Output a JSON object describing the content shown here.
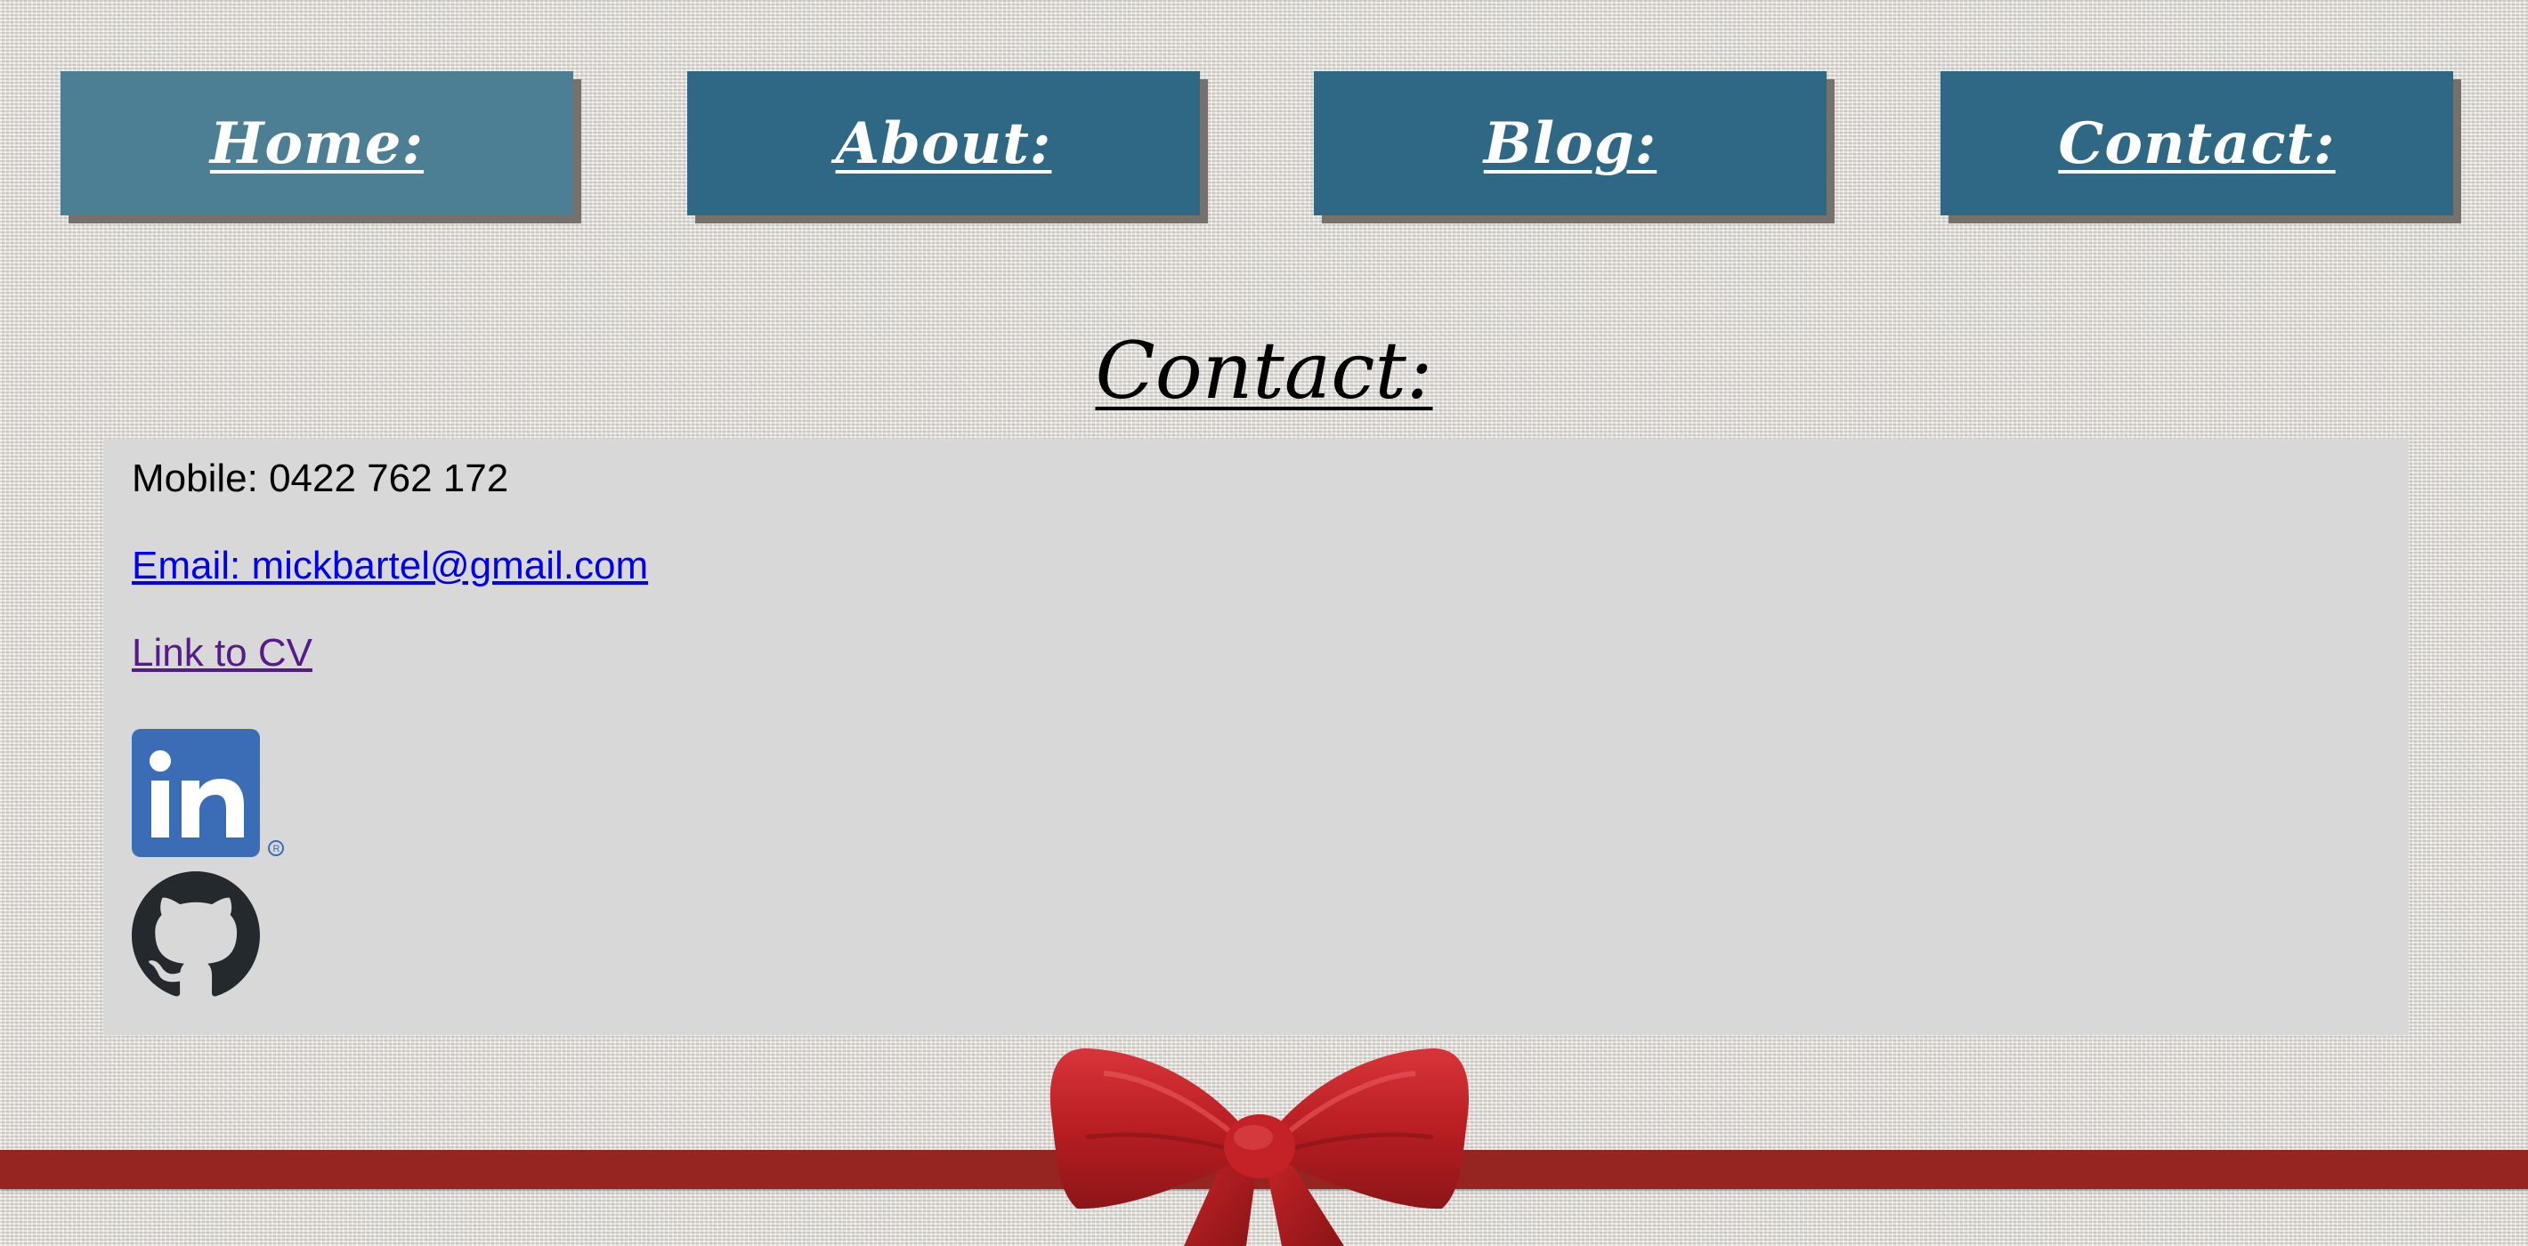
{
  "nav": {
    "items": [
      {
        "label": "Home:",
        "active": true
      },
      {
        "label": "About:",
        "active": false
      },
      {
        "label": "Blog:",
        "active": false
      },
      {
        "label": "Contact:",
        "active": false
      }
    ]
  },
  "page": {
    "title": "Contact:"
  },
  "contact": {
    "mobile": "Mobile: 0422 762 172",
    "email_link": "Email: mickbartel@gmail.com",
    "cv_link": "Link to CV",
    "linkedin_icon": "linkedin-icon",
    "github_icon": "github-icon"
  },
  "colors": {
    "nav_button": "#2e6885",
    "nav_button_active": "#4d7f94",
    "panel": "#d8d8d8",
    "ribbon": "#962420",
    "link": "#0000ee",
    "visited_link": "#551a8b"
  }
}
